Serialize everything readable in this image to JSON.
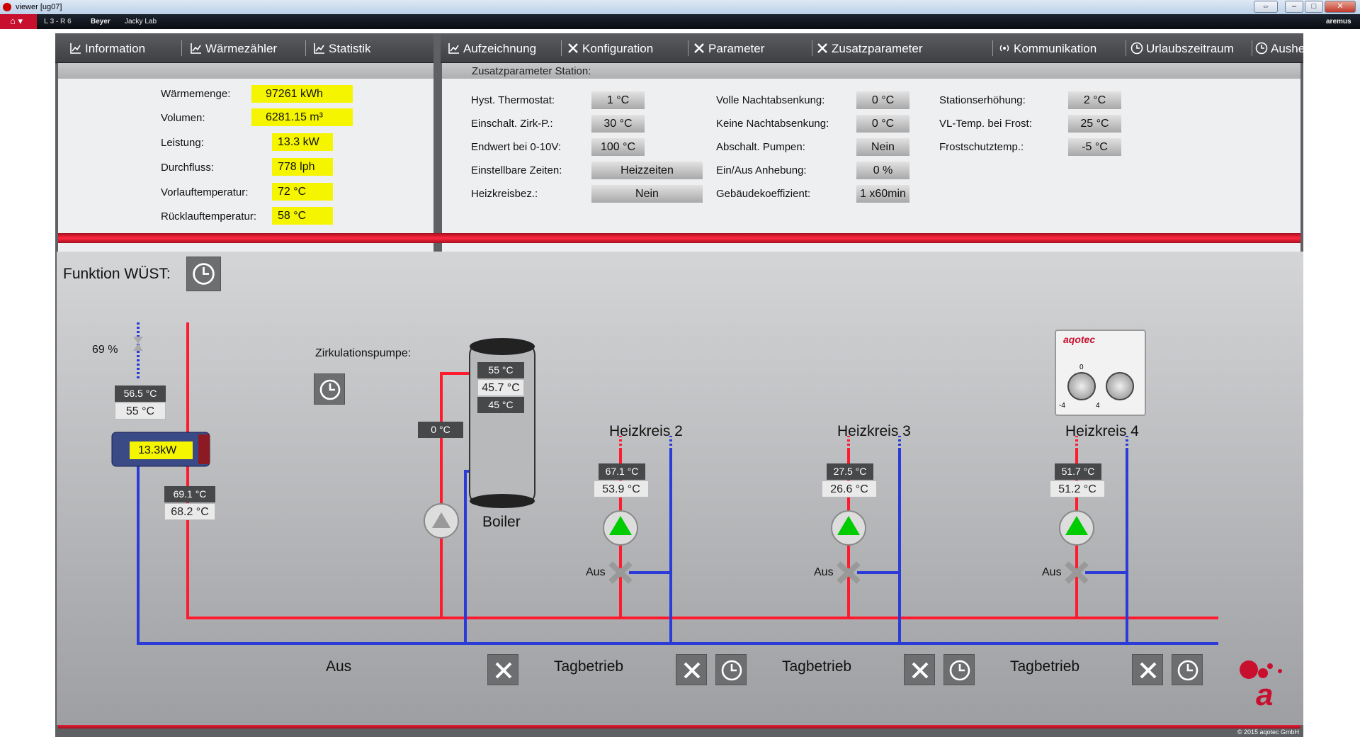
{
  "window": {
    "title": "viewer  [ug07]"
  },
  "taskbar": {
    "items": [
      "L 3 - R 6",
      "Beyer",
      "Jacky Lab"
    ],
    "brand": "aremus"
  },
  "tabs_left": [
    "Information",
    "Wärmezähler",
    "Statistik"
  ],
  "tabs_right": [
    "Aufzeichnung",
    "Konfiguration",
    "Parameter",
    "Zusatzparameter",
    "Kommunikation",
    "Urlaubszeitraum",
    "Ausheizung"
  ],
  "info": {
    "rows": [
      {
        "label": "Wärmemenge:",
        "value": "97261 kWh"
      },
      {
        "label": "Volumen:",
        "value": "6281.15 m³"
      },
      {
        "label": "Leistung:",
        "value": "13.3 kW"
      },
      {
        "label": "Durchfluss:",
        "value": "778 lph"
      },
      {
        "label": "Vorlauftemperatur:",
        "value": "72 °C"
      },
      {
        "label": "Rücklauftemperatur:",
        "value": "58 °C"
      }
    ]
  },
  "zusatz": {
    "header": "Zusatzparameter Station:",
    "col1": [
      {
        "label": "Hyst. Thermostat:",
        "value": "1 °C"
      },
      {
        "label": "Einschalt. Zirk-P.:",
        "value": "30 °C"
      },
      {
        "label": "Endwert bei 0-10V:",
        "value": "100 °C"
      },
      {
        "label": "Einstellbare Zeiten:",
        "value": "Heizzeiten"
      },
      {
        "label": "Heizkreisbez.:",
        "value": "Nein"
      }
    ],
    "col2": [
      {
        "label": "Volle Nachtabsenkung:",
        "value": "0 °C"
      },
      {
        "label": "Keine Nachtabsenkung:",
        "value": "0 °C"
      },
      {
        "label": "Abschalt. Pumpen:",
        "value": "Nein"
      },
      {
        "label": "Ein/Aus Anhebung:",
        "value": "0 %"
      },
      {
        "label": "Gebäudekoeffizient:",
        "value": "1 x60min"
      }
    ],
    "col3": [
      {
        "label": "Stationserhöhung:",
        "value": "2 °C"
      },
      {
        "label": "VL-Temp. bei Frost:",
        "value": "25 °C"
      },
      {
        "label": "Frostschutztemp.:",
        "value": "-5 °C"
      }
    ]
  },
  "schematic": {
    "funktion": "Funktion WÜST:",
    "valve_pct": "69 %",
    "hx_in_d": "56.5 °C",
    "hx_in_l": "55 °C",
    "hx_power": "13.3kW",
    "hx_out_d": "69.1 °C",
    "hx_out_l": "68.2 °C",
    "zirk_label": "Zirkulationspumpe:",
    "zirk_temp": "0 °C",
    "boiler_label": "Boiler",
    "boiler_t1": "55 °C",
    "boiler_t2": "45.7 °C",
    "boiler_t3": "45 °C",
    "circuits": [
      {
        "name": "Heizkreis 2",
        "t_d": "67.1 °C",
        "t_l": "53.9 °C",
        "valve": "Aus",
        "mode": "Tagbetrieb"
      },
      {
        "name": "Heizkreis 3",
        "t_d": "27.5 °C",
        "t_l": "26.6 °C",
        "valve": "Aus",
        "mode": "Tagbetrieb"
      },
      {
        "name": "Heizkreis 4",
        "t_d": "51.7 °C",
        "t_l": "51.2 °C",
        "valve": "Aus",
        "mode": "Tagbetrieb"
      }
    ],
    "boiler_mode": "Aus",
    "thermostat": {
      "brand": "aqotec",
      "scale_mid": "0",
      "scale_min": "-4",
      "scale_max": "4"
    }
  },
  "footer": "© 2015 aqotec GmbH",
  "colors": {
    "hot": "#ff1a2e",
    "cold": "#2838e0",
    "highlight": "#f5f500"
  }
}
